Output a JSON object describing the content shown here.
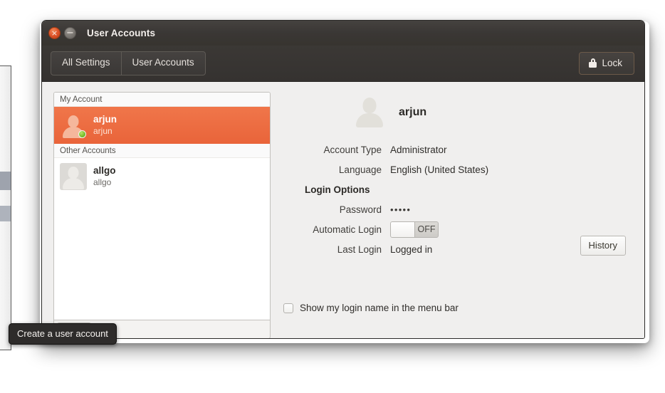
{
  "window": {
    "title": "User Accounts",
    "close_glyph": "×",
    "minimize_glyph": "−"
  },
  "toolbar": {
    "tabs": [
      {
        "label": "All Settings"
      },
      {
        "label": "User Accounts"
      }
    ],
    "lock_label": "Lock"
  },
  "account_list": {
    "groups": [
      {
        "header": "My Account",
        "accounts": [
          {
            "name": "arjun",
            "username": "arjun",
            "selected": true,
            "online": true
          }
        ]
      },
      {
        "header": "Other Accounts",
        "accounts": [
          {
            "name": "allgo",
            "username": "allgo",
            "selected": false,
            "online": false
          }
        ]
      }
    ],
    "add_label": "+",
    "remove_label": "−"
  },
  "details": {
    "username": "arjun",
    "account_type_label": "Account Type",
    "account_type_value": "Administrator",
    "language_label": "Language",
    "language_value": "English (United States)",
    "login_options_label": "Login Options",
    "password_label": "Password",
    "password_value": "•••••",
    "automatic_login_label": "Automatic Login",
    "automatic_login_state": "OFF",
    "last_login_label": "Last Login",
    "last_login_value": "Logged in",
    "history_label": "History",
    "menu_bar_option_label": "Show my login name in the menu bar"
  },
  "tooltip": {
    "text": "Create a user account"
  },
  "colors": {
    "selection_orange": "#e9643a",
    "titlebar_dark": "#3a3735",
    "window_bg": "#f0efee",
    "online_green": "#73bd2a"
  }
}
